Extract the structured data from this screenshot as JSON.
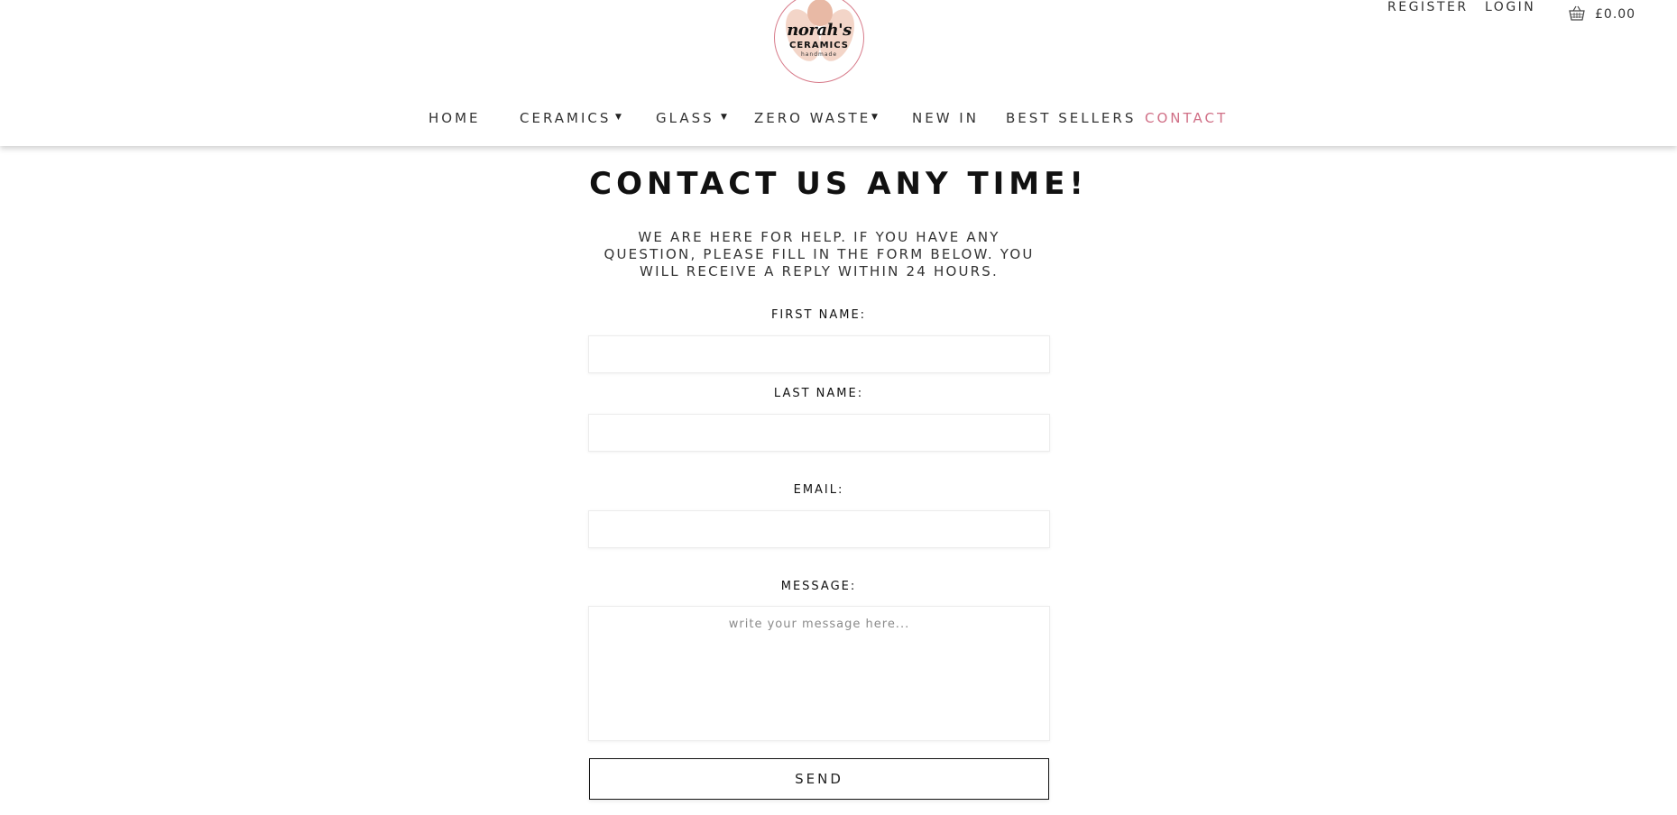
{
  "brand": {
    "logo_text": "norah's",
    "logo_sub": "CERAMICS",
    "logo_tiny": "handmade"
  },
  "top_links": {
    "register": "REGISTER",
    "login": "LOGIN",
    "cart_total": "£0.00"
  },
  "nav": {
    "home": "HOME",
    "ceramics": "CERAMICS",
    "glass": "GLASS",
    "zero_waste": "ZERO WASTE",
    "new_in": "NEW IN",
    "best_sellers": "BEST SELLERS",
    "contact": "CONTACT",
    "caret": "▼",
    "active_color": "#d06f86"
  },
  "contact": {
    "title": "CONTACT US ANY TIME!",
    "intro": "WE ARE HERE FOR HELP. IF YOU HAVE ANY QUESTION, PLEASE FILL IN THE FORM BELOW. YOU WILL RECEIVE A REPLY WITHIN 24 HOURS.",
    "first_name_label": "FIRST NAME:",
    "last_name_label": "LAST NAME:",
    "email_label": "EMAIL:",
    "message_label": "MESSAGE:",
    "message_placeholder": "write your message here...",
    "first_name_value": "",
    "last_name_value": "",
    "email_value": "",
    "send_label": "SEND"
  },
  "icons": {
    "basket": "basket-icon",
    "dropdown": "caret-down-icon"
  }
}
